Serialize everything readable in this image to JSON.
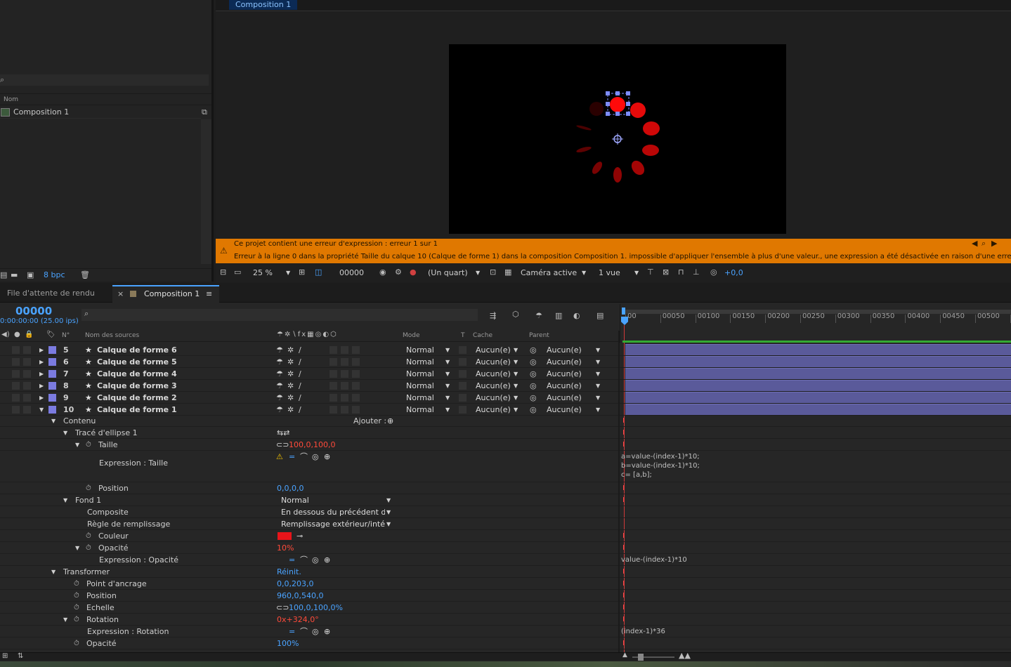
{
  "project": {
    "search_placeholder": "",
    "col_name": "Nom",
    "items": [
      {
        "name": "Composition 1"
      }
    ],
    "bpc": "8 bpc"
  },
  "viewer": {
    "tab": "Composition 1",
    "error_title": "Ce projet contient une erreur d'expression : erreur 1 sur 1",
    "error_detail": "Erreur à la ligne 0 dans la propriété Taille du calque 10 (Calque de forme 1) dans la composition Composition 1. impossible d'appliquer l'ensemble à plus d'une valeur., une expression a été désactivée en raison d'une erreur.",
    "zoom": "25 %",
    "timecode": "00000",
    "resolution": "(Un quart)",
    "camera": "Caméra active",
    "views": "1 vue",
    "exposure": "+0,0"
  },
  "timeline": {
    "tabs": {
      "render_queue": "File d'attente de rendu",
      "comp": "Composition 1"
    },
    "timecode": "00000",
    "timecode_sub": "0:00:00:00 (25.00 ips)",
    "headers": {
      "num": "N°",
      "source": "Nom des sources",
      "mode": "Mode",
      "t": "T",
      "cache": "Cache",
      "parent": "Parent"
    },
    "ruler": [
      "00",
      "00050",
      "00100",
      "00150",
      "00200",
      "00250",
      "00300",
      "00350",
      "00400",
      "00450",
      "00500",
      "005"
    ],
    "layers": [
      {
        "num": "5",
        "name": "Calque de forme 6",
        "mode": "Normal",
        "cache": "Aucun(e)",
        "parent": "Aucun(e)"
      },
      {
        "num": "6",
        "name": "Calque de forme 5",
        "mode": "Normal",
        "cache": "Aucun(e)",
        "parent": "Aucun(e)"
      },
      {
        "num": "7",
        "name": "Calque de forme 4",
        "mode": "Normal",
        "cache": "Aucun(e)",
        "parent": "Aucun(e)"
      },
      {
        "num": "8",
        "name": "Calque de forme 3",
        "mode": "Normal",
        "cache": "Aucun(e)",
        "parent": "Aucun(e)"
      },
      {
        "num": "9",
        "name": "Calque de forme 2",
        "mode": "Normal",
        "cache": "Aucun(e)",
        "parent": "Aucun(e)"
      },
      {
        "num": "10",
        "name": "Calque de forme 1",
        "mode": "Normal",
        "cache": "Aucun(e)",
        "parent": "Aucun(e)"
      }
    ],
    "props": {
      "contenu": "Contenu",
      "ajouter": "Ajouter :",
      "ellipse": "Tracé d'ellipse 1",
      "taille": "Taille",
      "taille_val": "100,0,100,0",
      "expr_taille": "Expression : Taille",
      "expr_taille_code": [
        "a=value-(index-1)*10;",
        "b=value-(index-1)*10;",
        "c= [a,b];"
      ],
      "position": "Position",
      "position_val": "0,0,0,0",
      "fond": "Fond 1",
      "fond_mode": "Normal",
      "composite": "Composite",
      "composite_val": "En dessous du précédent da",
      "regle": "Règle de remplissage",
      "regle_val": "Remplissage extérieur/intéi",
      "couleur": "Couleur",
      "couleur_hex": "#e8141a",
      "opacite": "Opacité",
      "opacite_val": "10%",
      "expr_opacite": "Expression : Opacité",
      "expr_opacite_code": "value-(index-1)*10",
      "transformer": "Transformer",
      "reinit": "Réinit.",
      "ancrage": "Point d'ancrage",
      "ancrage_val": "0,0,203,0",
      "t_position": "Position",
      "t_position_val": "960,0,540,0",
      "echelle": "Echelle",
      "echelle_val": "100,0,100,0%",
      "rotation": "Rotation",
      "rotation_val": "0x+324,0°",
      "expr_rotation": "Expression : Rotation",
      "expr_rotation_code": "(index-1)*36",
      "t_opacite": "Opacité",
      "t_opacite_val": "100%"
    }
  }
}
